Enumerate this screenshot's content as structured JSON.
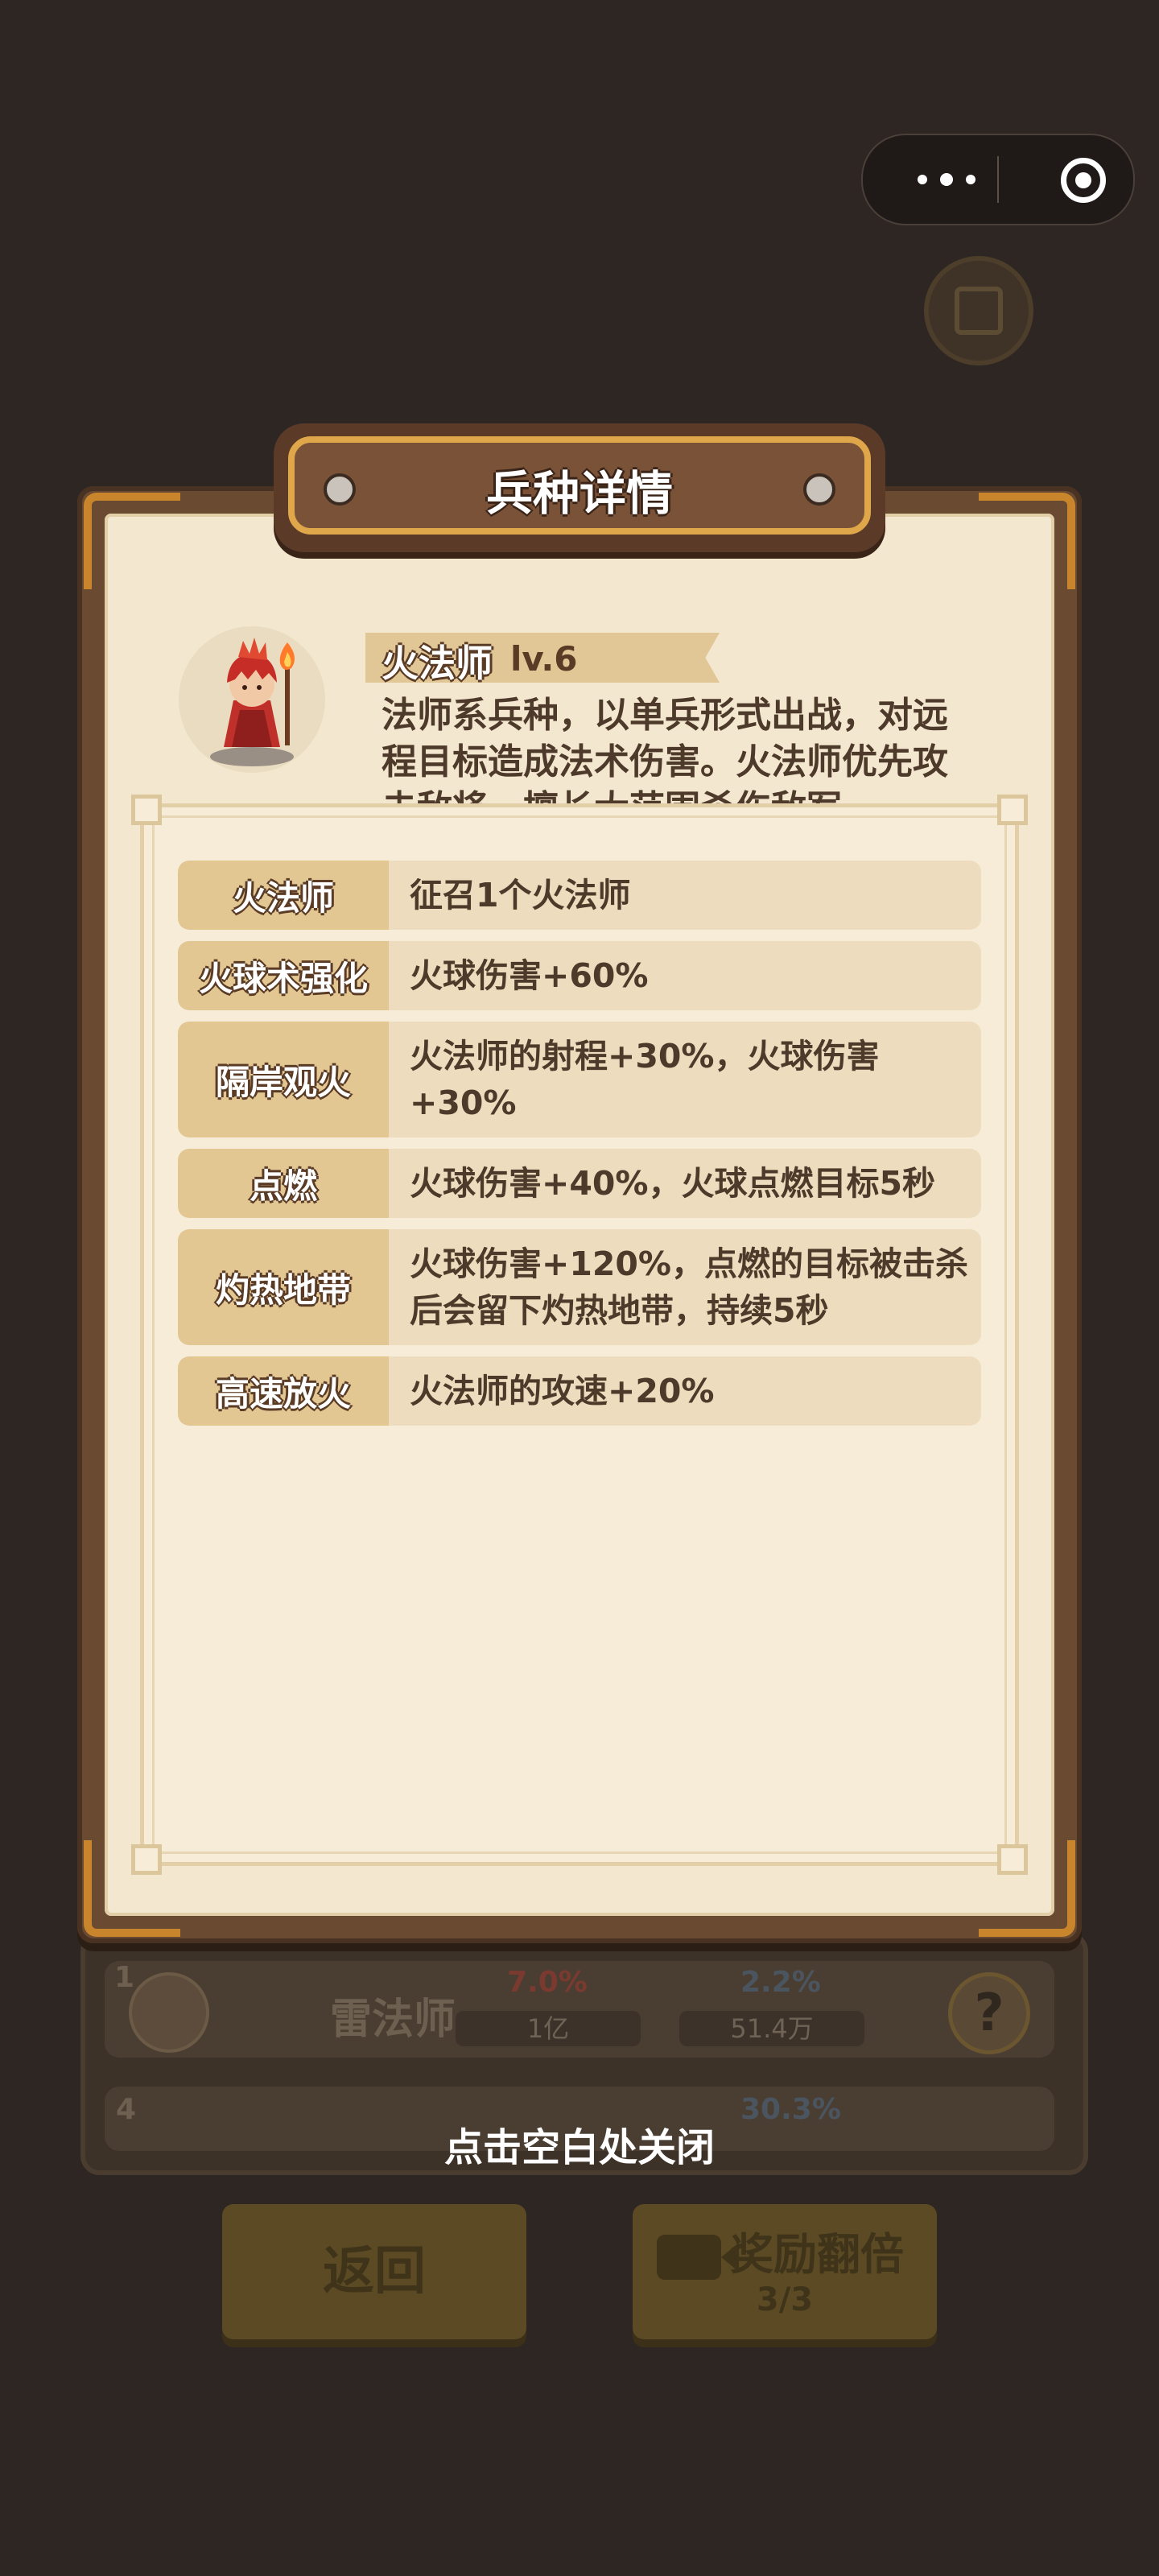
{
  "background": {
    "row1": {
      "level": "1",
      "name": "雷法师",
      "attack_pct": "7.0%",
      "defense_pct": "2.2%",
      "attack_value": "1亿",
      "defense_value": "51.4万"
    },
    "row2": {
      "level": "4",
      "defense_pct": "30.3%"
    },
    "back_button": "返回",
    "double_reward_button": "奖励翻倍",
    "double_reward_count": "3/3"
  },
  "dialog": {
    "title": "兵种详情",
    "unit": {
      "name": "火法师",
      "level": "lv.6",
      "description": "法师系兵种，以单兵形式出战，对远程目标造成法术伤害。火法师优先攻击敌将，擅长大范围杀伤敌军"
    },
    "skills": [
      {
        "name": "火法师",
        "effect": "征召1个火法师"
      },
      {
        "name": "火球术强化",
        "effect": "火球伤害+60%"
      },
      {
        "name": "隔岸观火",
        "effect": "火法师的射程+30%，火球伤害+30%"
      },
      {
        "name": "点燃",
        "effect": "火球伤害+40%，火球点燃目标5秒"
      },
      {
        "name": "灼热地带",
        "effect": "火球伤害+120%，点燃的目标被击杀后会留下灼热地带，持续5秒"
      },
      {
        "name": "高速放火",
        "effect": "火法师的攻速+20%"
      }
    ]
  },
  "close_hint": "点击空白处关闭",
  "colors": {
    "overlay_bg": "#2e2622",
    "frame_wood": "#6a4a31",
    "frame_gold": "#c9852c",
    "paper": "#f3e7cf",
    "label_bg": "#e2c793",
    "text_brown": "#4e3a2a"
  }
}
